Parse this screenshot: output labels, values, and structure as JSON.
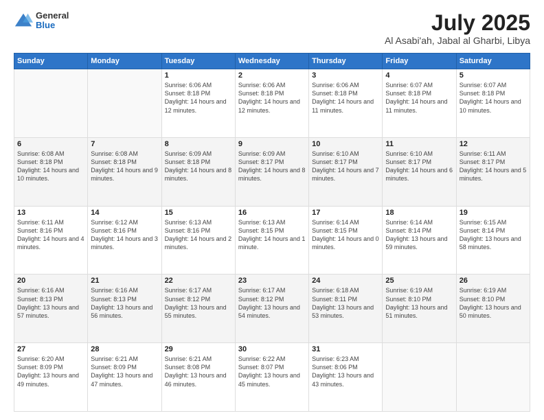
{
  "header": {
    "logo_general": "General",
    "logo_blue": "Blue",
    "title": "July 2025",
    "subtitle": "Al Asabi'ah, Jabal al Gharbi, Libya"
  },
  "days_of_week": [
    "Sunday",
    "Monday",
    "Tuesday",
    "Wednesday",
    "Thursday",
    "Friday",
    "Saturday"
  ],
  "weeks": [
    [
      {
        "day": "",
        "info": ""
      },
      {
        "day": "",
        "info": ""
      },
      {
        "day": "1",
        "info": "Sunrise: 6:06 AM\nSunset: 8:18 PM\nDaylight: 14 hours and 12 minutes."
      },
      {
        "day": "2",
        "info": "Sunrise: 6:06 AM\nSunset: 8:18 PM\nDaylight: 14 hours and 12 minutes."
      },
      {
        "day": "3",
        "info": "Sunrise: 6:06 AM\nSunset: 8:18 PM\nDaylight: 14 hours and 11 minutes."
      },
      {
        "day": "4",
        "info": "Sunrise: 6:07 AM\nSunset: 8:18 PM\nDaylight: 14 hours and 11 minutes."
      },
      {
        "day": "5",
        "info": "Sunrise: 6:07 AM\nSunset: 8:18 PM\nDaylight: 14 hours and 10 minutes."
      }
    ],
    [
      {
        "day": "6",
        "info": "Sunrise: 6:08 AM\nSunset: 8:18 PM\nDaylight: 14 hours and 10 minutes."
      },
      {
        "day": "7",
        "info": "Sunrise: 6:08 AM\nSunset: 8:18 PM\nDaylight: 14 hours and 9 minutes."
      },
      {
        "day": "8",
        "info": "Sunrise: 6:09 AM\nSunset: 8:18 PM\nDaylight: 14 hours and 8 minutes."
      },
      {
        "day": "9",
        "info": "Sunrise: 6:09 AM\nSunset: 8:17 PM\nDaylight: 14 hours and 8 minutes."
      },
      {
        "day": "10",
        "info": "Sunrise: 6:10 AM\nSunset: 8:17 PM\nDaylight: 14 hours and 7 minutes."
      },
      {
        "day": "11",
        "info": "Sunrise: 6:10 AM\nSunset: 8:17 PM\nDaylight: 14 hours and 6 minutes."
      },
      {
        "day": "12",
        "info": "Sunrise: 6:11 AM\nSunset: 8:17 PM\nDaylight: 14 hours and 5 minutes."
      }
    ],
    [
      {
        "day": "13",
        "info": "Sunrise: 6:11 AM\nSunset: 8:16 PM\nDaylight: 14 hours and 4 minutes."
      },
      {
        "day": "14",
        "info": "Sunrise: 6:12 AM\nSunset: 8:16 PM\nDaylight: 14 hours and 3 minutes."
      },
      {
        "day": "15",
        "info": "Sunrise: 6:13 AM\nSunset: 8:16 PM\nDaylight: 14 hours and 2 minutes."
      },
      {
        "day": "16",
        "info": "Sunrise: 6:13 AM\nSunset: 8:15 PM\nDaylight: 14 hours and 1 minute."
      },
      {
        "day": "17",
        "info": "Sunrise: 6:14 AM\nSunset: 8:15 PM\nDaylight: 14 hours and 0 minutes."
      },
      {
        "day": "18",
        "info": "Sunrise: 6:14 AM\nSunset: 8:14 PM\nDaylight: 13 hours and 59 minutes."
      },
      {
        "day": "19",
        "info": "Sunrise: 6:15 AM\nSunset: 8:14 PM\nDaylight: 13 hours and 58 minutes."
      }
    ],
    [
      {
        "day": "20",
        "info": "Sunrise: 6:16 AM\nSunset: 8:13 PM\nDaylight: 13 hours and 57 minutes."
      },
      {
        "day": "21",
        "info": "Sunrise: 6:16 AM\nSunset: 8:13 PM\nDaylight: 13 hours and 56 minutes."
      },
      {
        "day": "22",
        "info": "Sunrise: 6:17 AM\nSunset: 8:12 PM\nDaylight: 13 hours and 55 minutes."
      },
      {
        "day": "23",
        "info": "Sunrise: 6:17 AM\nSunset: 8:12 PM\nDaylight: 13 hours and 54 minutes."
      },
      {
        "day": "24",
        "info": "Sunrise: 6:18 AM\nSunset: 8:11 PM\nDaylight: 13 hours and 53 minutes."
      },
      {
        "day": "25",
        "info": "Sunrise: 6:19 AM\nSunset: 8:10 PM\nDaylight: 13 hours and 51 minutes."
      },
      {
        "day": "26",
        "info": "Sunrise: 6:19 AM\nSunset: 8:10 PM\nDaylight: 13 hours and 50 minutes."
      }
    ],
    [
      {
        "day": "27",
        "info": "Sunrise: 6:20 AM\nSunset: 8:09 PM\nDaylight: 13 hours and 49 minutes."
      },
      {
        "day": "28",
        "info": "Sunrise: 6:21 AM\nSunset: 8:09 PM\nDaylight: 13 hours and 47 minutes."
      },
      {
        "day": "29",
        "info": "Sunrise: 6:21 AM\nSunset: 8:08 PM\nDaylight: 13 hours and 46 minutes."
      },
      {
        "day": "30",
        "info": "Sunrise: 6:22 AM\nSunset: 8:07 PM\nDaylight: 13 hours and 45 minutes."
      },
      {
        "day": "31",
        "info": "Sunrise: 6:23 AM\nSunset: 8:06 PM\nDaylight: 13 hours and 43 minutes."
      },
      {
        "day": "",
        "info": ""
      },
      {
        "day": "",
        "info": ""
      }
    ]
  ]
}
